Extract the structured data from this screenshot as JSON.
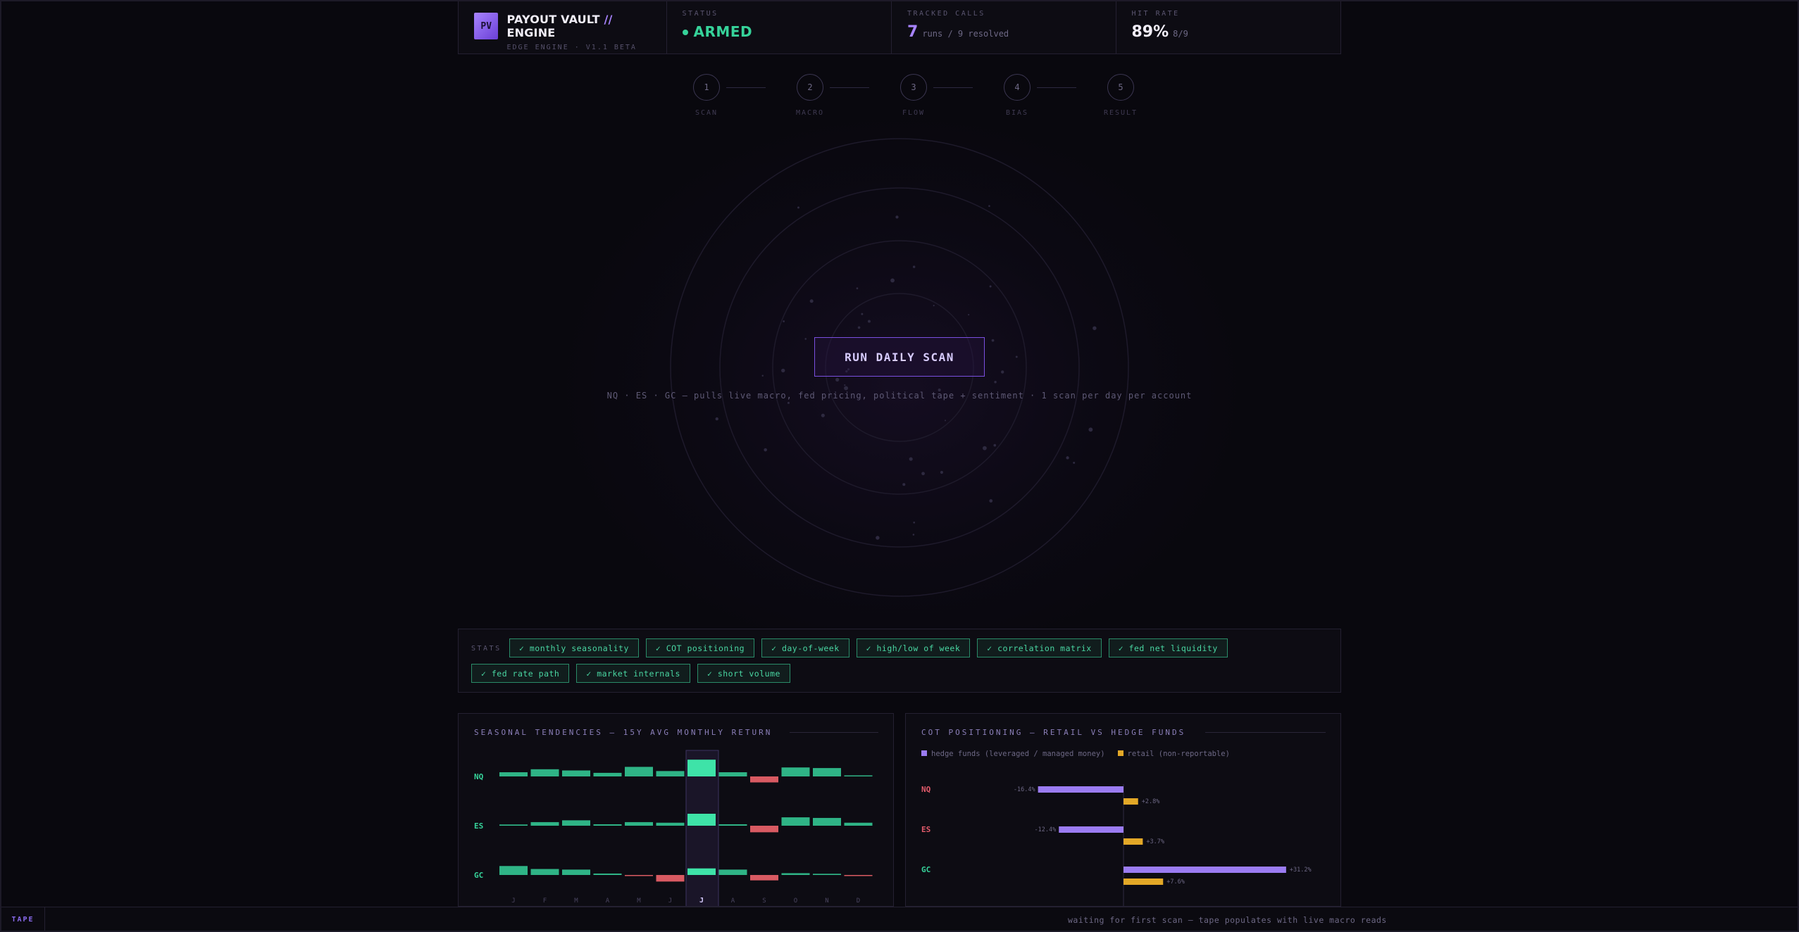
{
  "brand": {
    "logo": "PV",
    "title_a": "PAYOUT VAULT",
    "title_sep": "//",
    "title_b": "ENGINE",
    "subtitle": "EDGE ENGINE · V1.1 BETA"
  },
  "status": {
    "label": "STATUS",
    "value": "ARMED",
    "color": "#36d39a"
  },
  "calls": {
    "label": "TRACKED CALLS",
    "value": "7",
    "detail": "runs / 9 resolved"
  },
  "hit_rate": {
    "label": "HIT RATE",
    "value": "89%",
    "detail": "8/9"
  },
  "steps": [
    {
      "num": "1",
      "label": "SCAN"
    },
    {
      "num": "2",
      "label": "MACRO"
    },
    {
      "num": "3",
      "label": "FLOW"
    },
    {
      "num": "4",
      "label": "BIAS"
    },
    {
      "num": "5",
      "label": "RESULT"
    }
  ],
  "scan": {
    "button_label": "RUN DAILY SCAN",
    "note": "NQ · ES · GC — pulls live macro, fed pricing, political tape + sentiment · 1 scan per day per account"
  },
  "stats": {
    "label": "STATS",
    "chips": [
      "✓ monthly seasonality",
      "✓ COT positioning",
      "✓ day-of-week",
      "✓ high/low of week",
      "✓ correlation matrix",
      "✓ fed net liquidity",
      "✓ fed rate path",
      "✓ market internals",
      "✓ short volume"
    ]
  },
  "seasonal": {
    "title": "SEASONAL TENDENCIES — 15Y AVG MONTHLY RETURN",
    "months": [
      "J",
      "F",
      "M",
      "A",
      "M",
      "J",
      "J",
      "A",
      "S",
      "O",
      "N",
      "D"
    ],
    "highlight_index": 6,
    "rows": [
      {
        "label": "NQ",
        "values": [
          0.35,
          0.6,
          0.5,
          0.3,
          0.8,
          0.45,
          1.4,
          0.35,
          -0.5,
          0.75,
          0.7,
          0.05
        ]
      },
      {
        "label": "ES",
        "values": [
          0.1,
          0.3,
          0.45,
          0.12,
          0.3,
          0.25,
          1.0,
          0.12,
          -0.55,
          0.7,
          0.65,
          0.25
        ]
      },
      {
        "label": "GC",
        "values": [
          0.75,
          0.5,
          0.45,
          0.12,
          -0.05,
          -0.55,
          0.55,
          0.45,
          -0.45,
          0.15,
          0.1,
          -0.05
        ]
      }
    ],
    "colors": {
      "pos": "#2fb486",
      "pos_hl": "#3ee3a8",
      "neg": "#d85a62"
    }
  },
  "cot": {
    "title": "COT POSITIONING — RETAIL VS HEDGE FUNDS",
    "legend": [
      {
        "name": "hedge funds (leveraged / managed money)",
        "color": "#9b7cf2"
      },
      {
        "name": "retail (non-reportable)",
        "color": "#e3a827"
      }
    ],
    "rows": [
      {
        "label": "NQ",
        "label_color": "#e05a6a",
        "hedge": -16.4,
        "hedge_text": "-16.4%",
        "retail": 2.8,
        "retail_text": "+2.8%"
      },
      {
        "label": "ES",
        "label_color": "#e05a6a",
        "hedge": -12.4,
        "hedge_text": "-12.4%",
        "retail": 3.7,
        "retail_text": "+3.7%"
      },
      {
        "label": "GC",
        "label_color": "#36d39a",
        "hedge": 31.2,
        "hedge_text": "+31.2%",
        "retail": 7.6,
        "retail_text": "+7.6%"
      }
    ]
  },
  "tape": {
    "label": "TAPE",
    "message": "waiting for first scan — tape populates with live macro reads"
  }
}
